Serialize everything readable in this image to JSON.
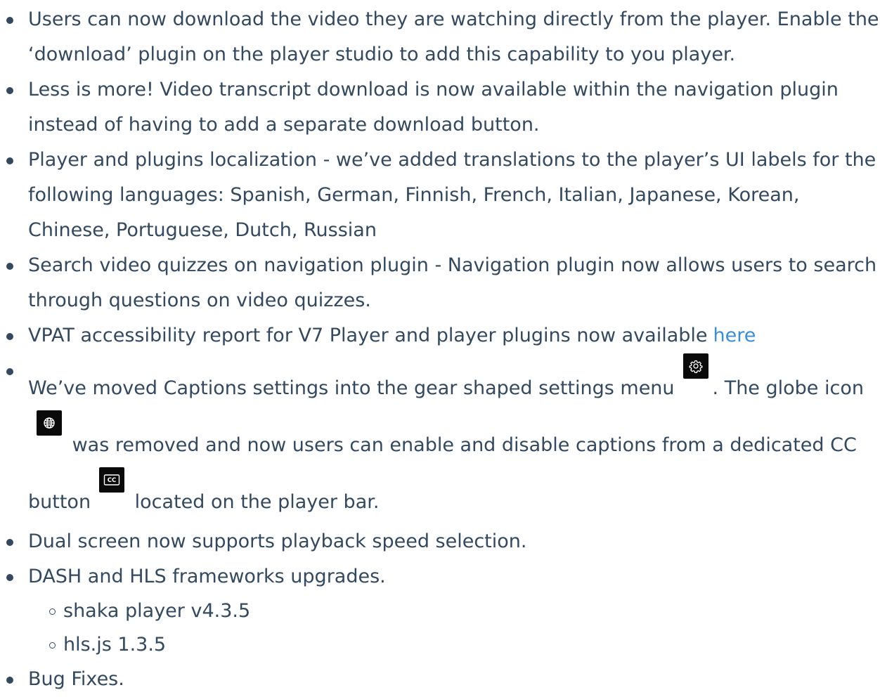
{
  "items": [
    {
      "text": "Users can now download the video they are watching directly from the player. Enable the ‘download’ plugin on the player studio to add this capability to you player."
    },
    {
      "text": "Less is more! Video transcript download is now available within the navigation plugin instead of having to add a separate download button."
    },
    {
      "text": "Player and plugins localization - we’ve added translations to the player’s UI labels for the following languages: Spanish, German, Finnish, French, Italian, Japanese, Korean, Chinese, Portuguese, Dutch, Russian"
    },
    {
      "text": "Search video quizzes on navigation plugin - Navigation plugin now allows users to search through questions on video quizzes."
    },
    {
      "text": "VPAT accessibility report for V7 Player and player plugins now available",
      "link_text": "here"
    },
    {
      "part1": "We’ve moved Captions settings into the gear shaped settings menu",
      "part2": ". The globe icon",
      "part3": "was removed and now users can enable and disable captions from a dedicated CC button",
      "part4": "located on the player bar.",
      "icons": [
        "gear-icon",
        "globe-icon",
        "closed-captions-icon"
      ]
    },
    {
      "text": "Dual screen now supports playback speed selection."
    },
    {
      "text": "DASH and HLS frameworks upgrades.",
      "sub_items": [
        "shaka player v4.3.5",
        "hls.js 1.3.5"
      ]
    },
    {
      "text": "Bug Fixes."
    }
  ],
  "colors": {
    "text": "#34495e",
    "link": "#3b8fd8",
    "icon_background": "#0a0a0a"
  }
}
